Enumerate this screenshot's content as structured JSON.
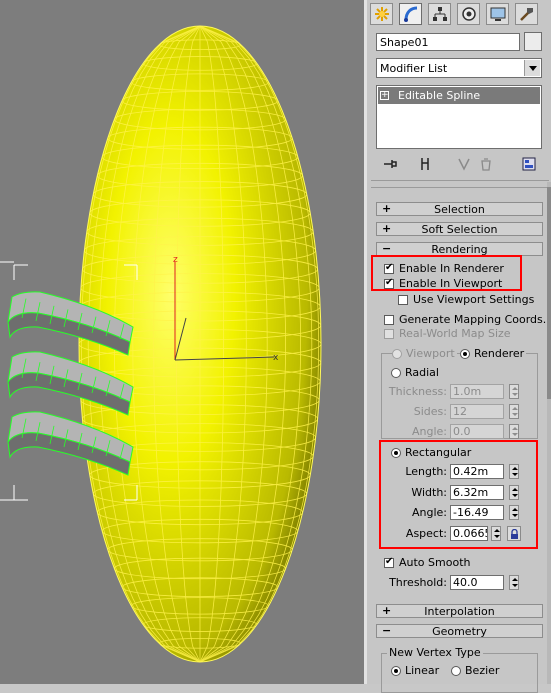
{
  "object_name": "Shape01",
  "modifier_list": "Modifier List",
  "modifier_stack": [
    {
      "expander": "+",
      "label": "Editable Spline"
    }
  ],
  "command_tabs": [
    "create-icon",
    "modify-icon",
    "hierarchy-icon",
    "motion-icon",
    "display-icon",
    "utilities-icon"
  ],
  "stack_tools": [
    "pin-stack-icon",
    "show-end-result-icon",
    "make-unique-icon",
    "remove-modifier-icon",
    "configure-modifier-sets-icon"
  ],
  "viewport": {
    "axis_z": "z",
    "axis_x": "x",
    "ellipsoid_color": "#f4f400",
    "selected_color": "#27ff27"
  },
  "rollouts": {
    "selection": {
      "sign": "+",
      "title": "Selection"
    },
    "soft_selection": {
      "sign": "+",
      "title": "Soft Selection"
    },
    "rendering": {
      "sign": "−",
      "title": "Rendering"
    },
    "interpolation": {
      "sign": "+",
      "title": "Interpolation"
    },
    "geometry": {
      "sign": "−",
      "title": "Geometry"
    }
  },
  "rendering": {
    "enable_in_renderer": {
      "label": "Enable In Renderer",
      "checked": true
    },
    "enable_in_viewport": {
      "label": "Enable In Viewport",
      "checked": true
    },
    "use_viewport_settings": {
      "label": "Use Viewport Settings",
      "checked": false
    },
    "generate_mapping": {
      "label": "Generate Mapping Coords.",
      "checked": false
    },
    "real_world_map": {
      "label": "Real-World Map Size",
      "checked": false
    },
    "viewport_radio": "Viewport",
    "renderer_radio": "Renderer",
    "radial": {
      "label": "Radial",
      "thickness_label": "Thickness:",
      "thickness": "1.0m",
      "sides_label": "Sides:",
      "sides": "12",
      "angle_label": "Angle:",
      "angle": "0.0"
    },
    "rectangular": {
      "label": "Rectangular",
      "length_label": "Length:",
      "length": "0.42m",
      "width_label": "Width:",
      "width": "6.32m",
      "angle_label": "Angle:",
      "angle": "-16.49",
      "aspect_label": "Aspect:",
      "aspect": "0.0665"
    },
    "auto_smooth": {
      "label": "Auto Smooth",
      "checked": true
    },
    "threshold_label": "Threshold:",
    "threshold": "40.0"
  },
  "geometry": {
    "new_vertex_type_label": "New Vertex Type",
    "linear": "Linear",
    "bezier": "Bezier"
  },
  "highlight_color": "#ff0000"
}
